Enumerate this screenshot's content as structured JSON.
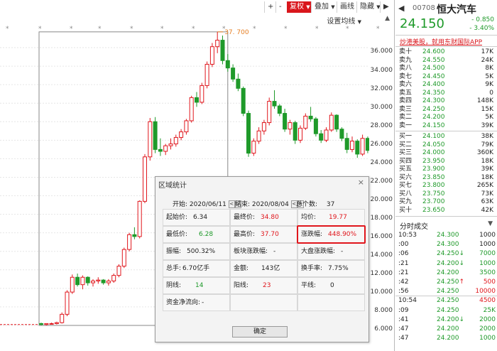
{
  "toolbar": {
    "buttons": [
      "+",
      "-",
      "复权",
      "叠加",
      "画线",
      "隐藏"
    ],
    "active": "复权",
    "indicator_setting": "设置均线",
    "collapse": "▲"
  },
  "chart": {
    "y_ticks": [
      "36.000",
      "34.000",
      "32.000",
      "30.000",
      "28.000",
      "26.000",
      "24.000",
      "22.000",
      "20.000",
      "18.000",
      "16.000",
      "14.000",
      "12.000",
      "10.000",
      "8.000",
      "6.000"
    ],
    "peak_label": "37. 700",
    "up_color": "#e0161c",
    "down_color": "#1f9a2a"
  },
  "chart_data": {
    "type": "candlestick",
    "ylim": [
      5,
      39
    ],
    "candles": [
      [
        6.2,
        6.3,
        6.0,
        6.1
      ],
      [
        6.1,
        6.2,
        6.0,
        6.2
      ],
      [
        6.2,
        6.3,
        6.1,
        6.2
      ],
      [
        6.2,
        6.4,
        6.1,
        6.3
      ],
      [
        6.3,
        7.4,
        6.2,
        7.2
      ],
      [
        7.2,
        9.8,
        7.0,
        9.6
      ],
      [
        9.6,
        11.5,
        9.4,
        11.2
      ],
      [
        11.2,
        11.6,
        10.2,
        10.4
      ],
      [
        10.4,
        11.4,
        9.9,
        11.2
      ],
      [
        11.2,
        11.3,
        10.3,
        10.6
      ],
      [
        10.6,
        11.0,
        10.2,
        10.8
      ],
      [
        10.8,
        11.2,
        10.5,
        10.9
      ],
      [
        10.9,
        11.0,
        10.4,
        10.6
      ],
      [
        10.6,
        11.0,
        10.3,
        10.8
      ],
      [
        10.8,
        11.6,
        10.6,
        11.4
      ],
      [
        11.4,
        12.6,
        11.2,
        12.4
      ],
      [
        12.4,
        14.4,
        12.2,
        14.2
      ],
      [
        14.2,
        16.0,
        14.0,
        15.8
      ],
      [
        15.8,
        16.6,
        15.3,
        15.6
      ],
      [
        15.6,
        19.5,
        15.4,
        19.4
      ],
      [
        19.4,
        24.5,
        19.2,
        24.2
      ],
      [
        24.2,
        28.4,
        23.8,
        28.0
      ],
      [
        28.0,
        28.5,
        24.6,
        25.0
      ],
      [
        25.0,
        26.2,
        24.3,
        24.8
      ],
      [
        24.8,
        25.6,
        24.4,
        25.4
      ],
      [
        25.4,
        26.2,
        25.0,
        25.6
      ],
      [
        25.6,
        26.6,
        25.3,
        26.3
      ],
      [
        26.3,
        27.2,
        26.0,
        26.9
      ],
      [
        26.9,
        28.3,
        26.6,
        28.1
      ],
      [
        28.1,
        30.8,
        27.9,
        30.6
      ],
      [
        30.6,
        31.2,
        29.6,
        30.1
      ],
      [
        30.1,
        32.2,
        29.9,
        31.9
      ],
      [
        31.9,
        34.5,
        31.6,
        34.2
      ],
      [
        34.2,
        36.5,
        33.9,
        36.1
      ],
      [
        36.1,
        37.7,
        35.4,
        36.8
      ],
      [
        36.8,
        37.3,
        34.2,
        34.6
      ],
      [
        34.6,
        35.3,
        33.4,
        33.8
      ],
      [
        33.8,
        34.2,
        32.3,
        32.6
      ],
      [
        32.6,
        33.2,
        31.3,
        31.6
      ],
      [
        31.6,
        31.8,
        28.6,
        28.9
      ],
      [
        28.9,
        29.2,
        24.2,
        24.6
      ],
      [
        24.6,
        26.2,
        24.3,
        25.9
      ],
      [
        25.9,
        27.4,
        25.6,
        27.0
      ],
      [
        27.0,
        28.2,
        26.6,
        27.9
      ],
      [
        27.9,
        30.6,
        27.6,
        30.2
      ],
      [
        30.2,
        31.4,
        29.4,
        29.7
      ],
      [
        29.7,
        29.9,
        28.6,
        28.9
      ],
      [
        28.9,
        29.4,
        26.9,
        27.2
      ],
      [
        27.2,
        28.2,
        26.6,
        27.9
      ],
      [
        27.9,
        28.1,
        25.6,
        26.0
      ],
      [
        26.0,
        27.6,
        25.7,
        27.3
      ],
      [
        27.3,
        28.9,
        27.1,
        28.6
      ],
      [
        28.6,
        29.6,
        28.0,
        28.3
      ],
      [
        28.3,
        28.5,
        26.4,
        26.7
      ],
      [
        26.7,
        27.1,
        25.7,
        26.0
      ],
      [
        26.0,
        27.4,
        25.8,
        27.1
      ],
      [
        27.1,
        29.0,
        26.9,
        28.7
      ],
      [
        28.7,
        28.8,
        26.9,
        27.2
      ],
      [
        27.2,
        27.4,
        25.9,
        26.2
      ],
      [
        26.2,
        26.8,
        24.6,
        25.0
      ],
      [
        25.0,
        26.4,
        24.7,
        25.9
      ],
      [
        25.9,
        26.1,
        24.1,
        24.5
      ],
      [
        24.5,
        26.6,
        24.3,
        26.2
      ],
      [
        26.2,
        26.4,
        24.6,
        24.9
      ],
      [
        24.9,
        25.2,
        23.6,
        24.2
      ]
    ]
  },
  "dialog": {
    "title": "区域统计",
    "close": "×",
    "start_label": "开始:",
    "start_date": "2020/06/11",
    "end_label": "结束:",
    "end_date": "2020/08/04",
    "count_label": "总个数:",
    "count": "37",
    "spin_left": "<",
    "spin_right": ">",
    "stats": {
      "open_label": "起始价:",
      "open": "6.34",
      "close_label": "最终价:",
      "close": "34.80",
      "avg_label": "均价:",
      "avg": "19.77",
      "low_label": "最低价:",
      "low": "6.28",
      "high_label": "最高价:",
      "high": "37.70",
      "pct_label": "涨跌幅:",
      "pct": "448.90%",
      "amp_label": "振幅:",
      "amp": "500.32%",
      "sector_label": "板块涨跌幅:",
      "sector": "-",
      "market_label": "大盘涨跌幅:",
      "market": "-",
      "hands_label": "总手:",
      "hands": "6.70亿手",
      "amount_label": "金额:",
      "amount": "143亿",
      "turnover_label": "换手率:",
      "turnover": "7.75%",
      "yin_label": "阴线:",
      "yin": "14",
      "yang_label": "阳线:",
      "yang": "23",
      "flat_label": "平线:",
      "flat": "0",
      "netflow_label": "资金净流向:",
      "netflow": "-"
    },
    "ok": "确定"
  },
  "quote": {
    "back": "◀",
    "code": "00708",
    "name": "恒大汽车",
    "price": "24.150",
    "change": "- 0.850",
    "change_pct": "- 3.40%",
    "banner": "炒港美股，就用东财国际APP",
    "asks": [
      {
        "level": "卖十",
        "price": "24.600",
        "vol": "17K"
      },
      {
        "level": "卖九",
        "price": "24.550",
        "vol": "24K"
      },
      {
        "level": "卖八",
        "price": "24.500",
        "vol": "8K"
      },
      {
        "level": "卖七",
        "price": "24.450",
        "vol": "5K"
      },
      {
        "level": "卖六",
        "price": "24.400",
        "vol": "9K"
      },
      {
        "level": "卖五",
        "price": "24.350",
        "vol": "0"
      },
      {
        "level": "卖四",
        "price": "24.300",
        "vol": "148K"
      },
      {
        "level": "卖三",
        "price": "24.250",
        "vol": "15K"
      },
      {
        "level": "卖二",
        "price": "24.200",
        "vol": "5K"
      },
      {
        "level": "卖一",
        "price": "24.150",
        "vol": "39K"
      }
    ],
    "bids": [
      {
        "level": "买一",
        "price": "24.100",
        "vol": "38K"
      },
      {
        "level": "买二",
        "price": "24.050",
        "vol": "79K"
      },
      {
        "level": "买三",
        "price": "24.000",
        "vol": "360K"
      },
      {
        "level": "买四",
        "price": "23.950",
        "vol": "18K"
      },
      {
        "level": "买五",
        "price": "23.900",
        "vol": "39K"
      },
      {
        "level": "买六",
        "price": "23.850",
        "vol": "18K"
      },
      {
        "level": "买七",
        "price": "23.800",
        "vol": "265K"
      },
      {
        "level": "买八",
        "price": "23.750",
        "vol": "73K"
      },
      {
        "level": "买九",
        "price": "23.700",
        "vol": "63K"
      },
      {
        "level": "买十",
        "price": "23.650",
        "vol": "42K"
      }
    ],
    "ticks_title": "分时成交",
    "ticks_collapse": "▼",
    "ticks": [
      {
        "time": "10:53",
        "price": "24.300",
        "arrow": "",
        "vol": "1000",
        "vol_color": "#222222"
      },
      {
        "time": ":00",
        "price": "24.300",
        "arrow": "",
        "vol": "1000",
        "vol_color": "#222222"
      },
      {
        "time": ":06",
        "price": "24.250",
        "arrow": "↓",
        "vol": "7000",
        "vol_color": "#1f9a2a"
      },
      {
        "time": ":21",
        "price": "24.200",
        "arrow": "↓",
        "vol": "1000",
        "vol_color": "#1f9a2a"
      },
      {
        "time": ":21",
        "price": "24.200",
        "arrow": "",
        "vol": "3500",
        "vol_color": "#1f9a2a"
      },
      {
        "time": ":42",
        "price": "24.250",
        "arrow": "↑",
        "vol": "500",
        "vol_color": "#e0161c"
      },
      {
        "time": ":56",
        "price": "24.250",
        "arrow": "",
        "vol": "10000",
        "vol_color": "#e0161c"
      },
      {
        "time": "10:54",
        "price": "24.250",
        "arrow": "",
        "vol": "4500",
        "vol_color": "#e0161c"
      },
      {
        "time": ":09",
        "price": "24.250",
        "arrow": "",
        "vol": "25K",
        "vol_color": "#1f9a2a"
      },
      {
        "time": ":41",
        "price": "24.200",
        "arrow": "↓",
        "vol": "2000",
        "vol_color": "#1f9a2a"
      },
      {
        "time": ":47",
        "price": "24.200",
        "arrow": "",
        "vol": "2000",
        "vol_color": "#1f9a2a"
      },
      {
        "time": ":47",
        "price": "24.200",
        "arrow": "",
        "vol": "1000",
        "vol_color": "#1f9a2a"
      }
    ]
  }
}
